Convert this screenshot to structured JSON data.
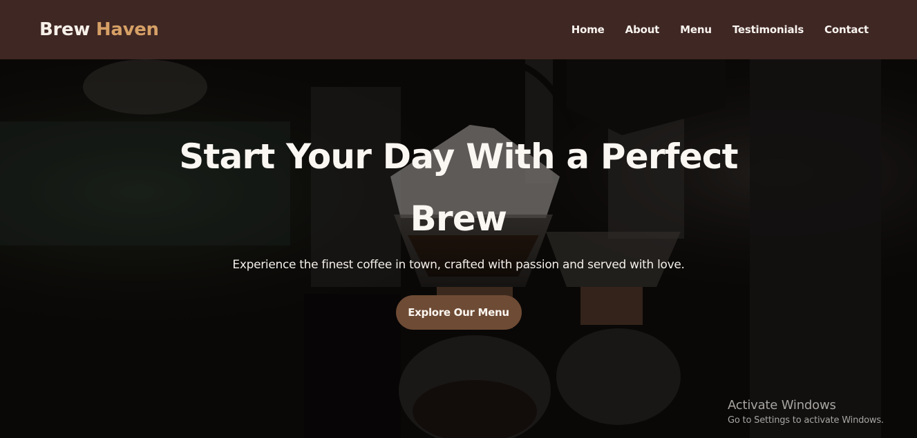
{
  "brand": {
    "name_part1": "Brew",
    "name_part2": "Haven",
    "accent_color": "#d6a066"
  },
  "nav": {
    "background": "#3f2724",
    "links": [
      "Home",
      "About",
      "Menu",
      "Testimonials",
      "Contact"
    ]
  },
  "hero": {
    "title": "Start Your Day With a Perfect Brew",
    "subtitle": "Experience the finest coffee in town, crafted with passion and served with love.",
    "cta_label": "Explore Our Menu",
    "cta_color": "#6e4b35",
    "background_image": "coffee-pour-over-photo"
  },
  "os_notice": {
    "title": "Activate Windows",
    "subtitle": "Go to Settings to activate Windows."
  }
}
